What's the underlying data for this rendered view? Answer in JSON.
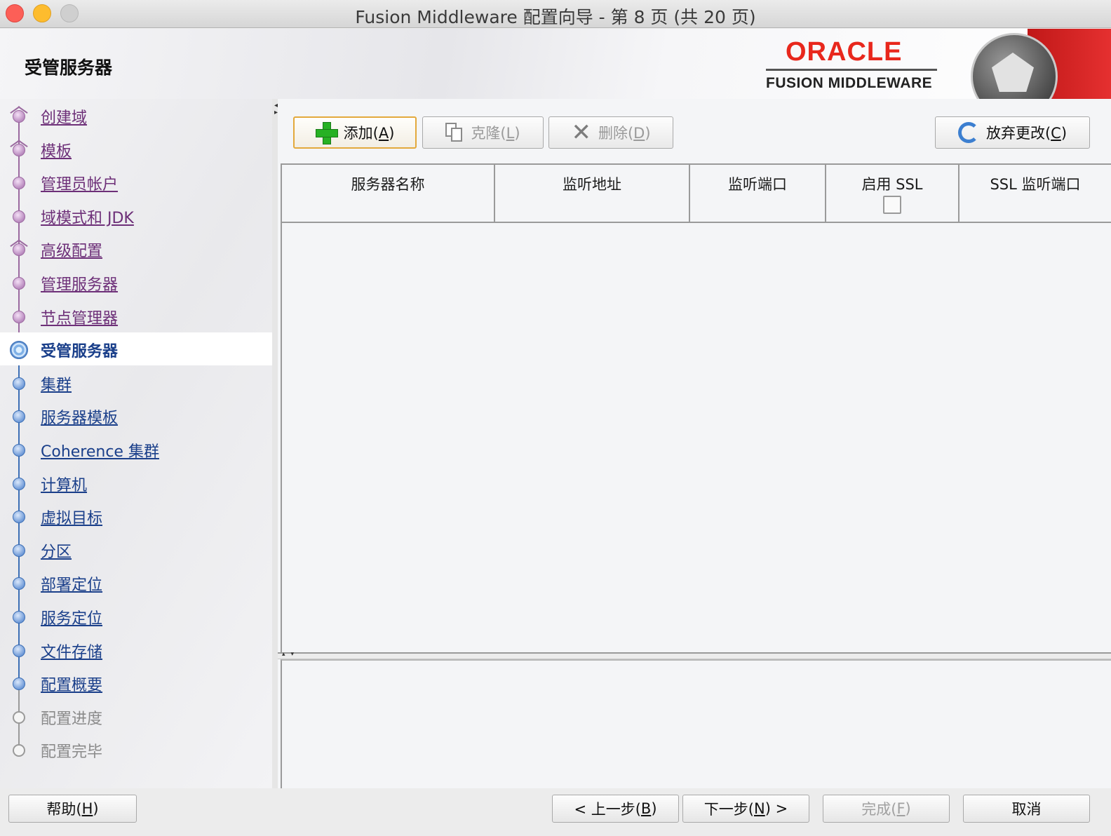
{
  "window": {
    "title": "Fusion Middleware 配置向导 - 第 8 页 (共 20 页)"
  },
  "header": {
    "page_heading": "受管服务器",
    "brand_top": "ORACLE",
    "brand_bottom": "FUSION MIDDLEWARE",
    "brand_color": "#e8271c"
  },
  "nav": {
    "items": [
      {
        "label": "创建域",
        "state": "done"
      },
      {
        "label": "模板",
        "state": "done"
      },
      {
        "label": "管理员帐户",
        "state": "done"
      },
      {
        "label": "域模式和 JDK",
        "state": "done"
      },
      {
        "label": "高级配置",
        "state": "done"
      },
      {
        "label": "管理服务器",
        "state": "done"
      },
      {
        "label": "节点管理器",
        "state": "done"
      },
      {
        "label": "受管服务器",
        "state": "current"
      },
      {
        "label": "集群",
        "state": "todo"
      },
      {
        "label": "服务器模板",
        "state": "todo"
      },
      {
        "label": "Coherence 集群",
        "state": "todo"
      },
      {
        "label": "计算机",
        "state": "todo"
      },
      {
        "label": "虚拟目标",
        "state": "todo"
      },
      {
        "label": "分区",
        "state": "todo"
      },
      {
        "label": "部署定位",
        "state": "todo"
      },
      {
        "label": "服务定位",
        "state": "todo"
      },
      {
        "label": "文件存储",
        "state": "todo"
      },
      {
        "label": "配置概要",
        "state": "todo"
      },
      {
        "label": "配置进度",
        "state": "disabled"
      },
      {
        "label": "配置完毕",
        "state": "disabled"
      }
    ]
  },
  "toolbar": {
    "add_label": "添加(",
    "add_key": "A",
    "clone_label": "克隆(",
    "clone_key": "L",
    "delete_label": "删除(",
    "delete_key": "D",
    "discard_label": "放弃更改(",
    "discard_key": "C",
    "close_paren": ")"
  },
  "table": {
    "columns": [
      "服务器名称",
      "监听地址",
      "监听端口",
      "启用 SSL",
      "SSL 监听端口"
    ],
    "rows": []
  },
  "footer": {
    "help_label": "帮助(",
    "help_key": "H",
    "back_label": "< 上一步(",
    "back_key": "B",
    "next_label": "下一步(",
    "next_key": "N",
    "next_suffix": ") >",
    "finish_label": "完成(",
    "finish_key": "F",
    "cancel_label": "取消",
    "close_paren": ")"
  }
}
